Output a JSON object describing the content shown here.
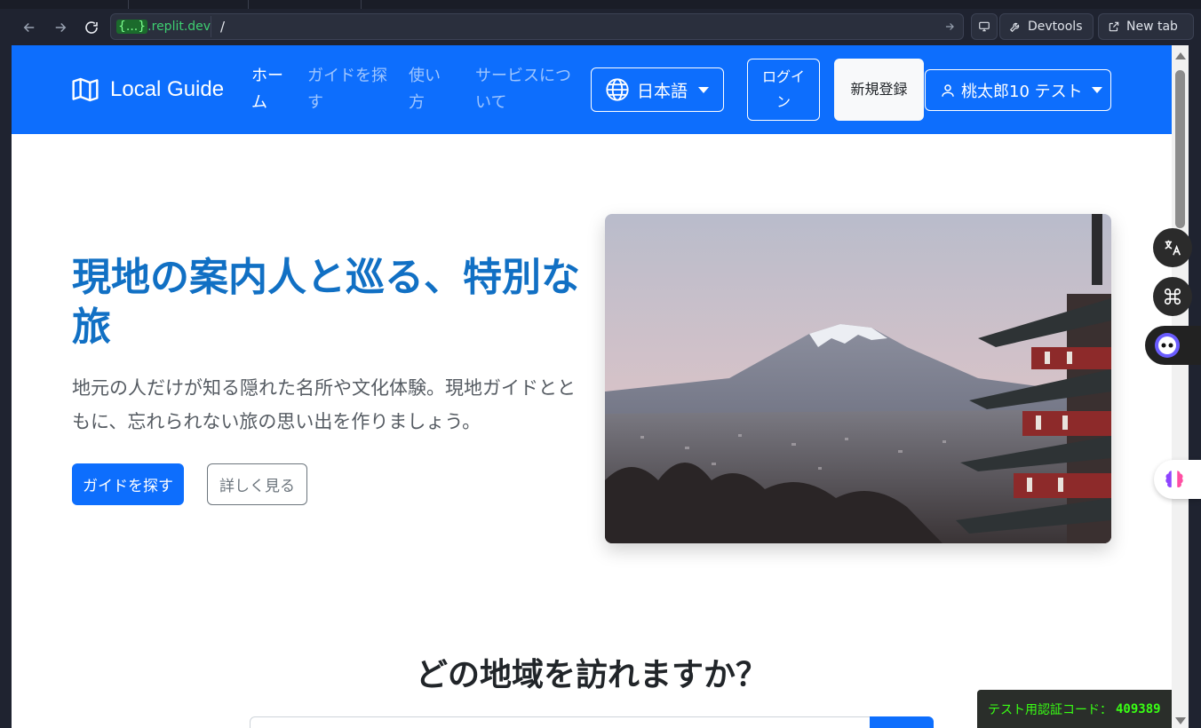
{
  "browser": {
    "url_host_highlight": "{...}",
    "url_host_rest": ".replit.dev",
    "url_path": "/",
    "devtools_label": "Devtools",
    "new_tab_label": "New tab"
  },
  "navbar": {
    "brand": "Local Guide",
    "links": [
      {
        "label": "ホーム",
        "active": true
      },
      {
        "label": "ガイドを探す",
        "active": false
      },
      {
        "label": "使い方",
        "active": false
      },
      {
        "label": "サービスについて",
        "active": false
      }
    ],
    "language": "日本語",
    "login": "ログイン",
    "signup": "新規登録",
    "user": "桃太郎10 テスト"
  },
  "hero": {
    "title": "現地の案内人と巡る、特別な旅",
    "lead": "地元の人だけが知る隠れた名所や文化体験。現地ガイドとともに、忘れられない旅の思い出を作りましょう。",
    "primary_button": "ガイドを探す",
    "secondary_button": "詳しく見る"
  },
  "region": {
    "title": "どの地域を訪れますか？"
  },
  "code_banner": {
    "label": "テスト用認証コード：",
    "code": "409389"
  },
  "colors": {
    "primary": "#0d6efd",
    "hero_title": "#1170c4",
    "banner_text": "#39ff14"
  }
}
